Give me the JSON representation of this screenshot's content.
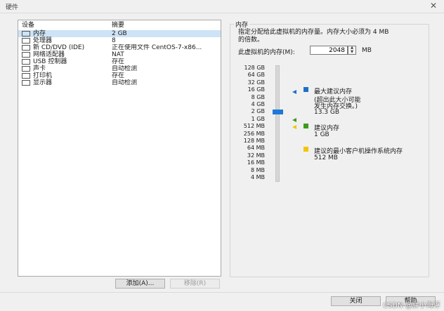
{
  "window": {
    "title": "硬件"
  },
  "devices": {
    "col_device": "设备",
    "col_summary": "摘要",
    "rows": [
      {
        "name": "内存",
        "summary": "2 GB",
        "icon": "memory-icon"
      },
      {
        "name": "处理器",
        "summary": "8",
        "icon": "cpu-icon"
      },
      {
        "name": "新 CD/DVD (IDE)",
        "summary": "正在使用文件 CentOS-7-x86...",
        "icon": "cd-dvd-icon"
      },
      {
        "name": "网络适配器",
        "summary": "NAT",
        "icon": "network-adapter-icon"
      },
      {
        "name": "USB 控制器",
        "summary": "存在",
        "icon": "usb-icon"
      },
      {
        "name": "声卡",
        "summary": "自动检测",
        "icon": "sound-card-icon"
      },
      {
        "name": "打印机",
        "summary": "存在",
        "icon": "printer-icon"
      },
      {
        "name": "显示器",
        "summary": "自动检测",
        "icon": "display-icon"
      }
    ],
    "add_label": "添加(A)...",
    "remove_label": "移除(R)"
  },
  "memory": {
    "group_title": "内存",
    "desc_line1": "指定分配给此虚拟机的内存量。内存大小必须为 4 MB",
    "desc_line2": "的倍数。",
    "field_label": "此虚拟机的内存(M):",
    "value": "2048",
    "unit": "MB",
    "scale": [
      "128 GB",
      "64 GB",
      "32 GB",
      "16 GB",
      "8 GB",
      "4 GB",
      "2 GB",
      "1 GB",
      "512 MB",
      "256 MB",
      "128 MB",
      "64 MB",
      "32 MB",
      "16 MB",
      "8 MB",
      "4 MB"
    ],
    "max_title": "最大建议内存",
    "max_note1": "(超出此大小可能",
    "max_note2": "发生内存交换。)",
    "max_value": "13.3 GB",
    "rec_title": "建议内存",
    "rec_value": "1 GB",
    "min_title": "建议的最小客户机操作系统内存",
    "min_value": "512 MB",
    "colors": {
      "max": "#1e6fc7",
      "rec": "#3e9a1f",
      "min": "#f3c500",
      "thumb": "#1e78d7"
    }
  },
  "footer": {
    "close_label": "关闭",
    "help_label": "帮助"
  },
  "watermark": "CSDN @胖小海浮"
}
